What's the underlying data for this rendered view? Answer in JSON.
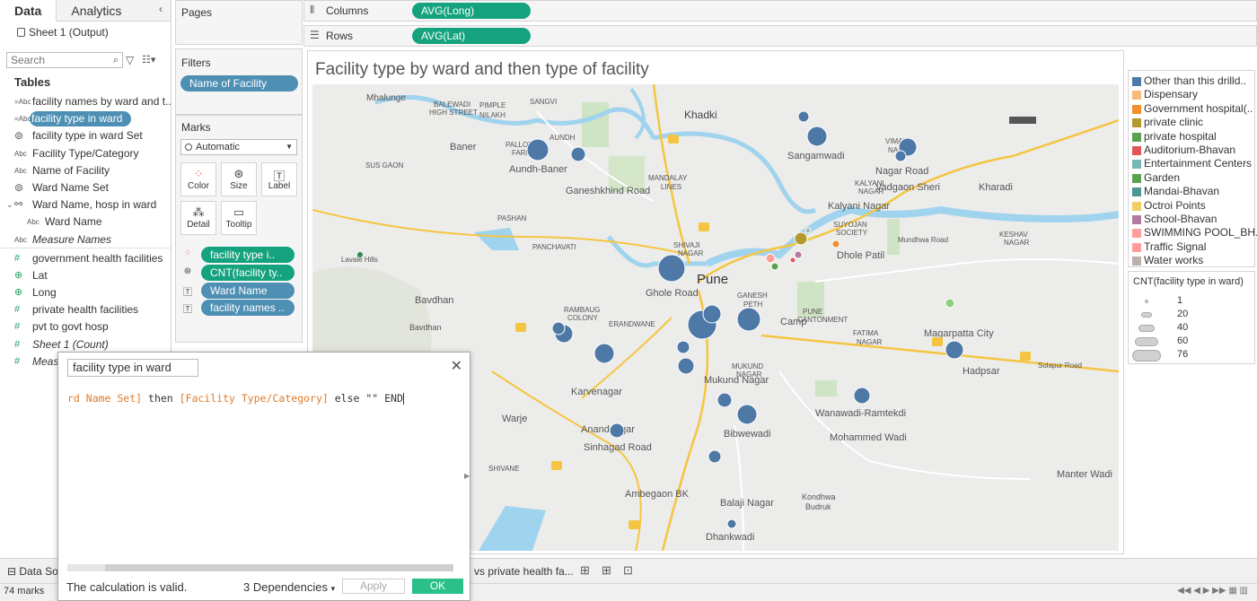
{
  "datapane": {
    "tabs": [
      "Data",
      "Analytics"
    ],
    "collapse_glyph": "‹",
    "source": "Sheet 1 (Output)",
    "search_placeholder": "Search",
    "tables_heading": "Tables",
    "fields": [
      {
        "label": "facility names by ward and t...",
        "icon": "Abc"
      },
      {
        "label": "facility type in ward",
        "icon": "Abc",
        "selected": true
      },
      {
        "label": "facility type in ward Set",
        "icon": "set"
      },
      {
        "label": "Facility Type/Category",
        "icon": "Abc"
      },
      {
        "label": "Name of Facility",
        "icon": "Abc"
      },
      {
        "label": "Ward Name Set",
        "icon": "set"
      },
      {
        "label": "Ward Name, hosp in ward",
        "icon": "hierarchy"
      },
      {
        "label": "Ward Name",
        "icon": "Abc"
      },
      {
        "label": "Measure Names",
        "icon": "Abc"
      },
      {
        "label": "government health facilities",
        "icon": "#"
      },
      {
        "label": "Lat",
        "icon": "globe"
      },
      {
        "label": "Long",
        "icon": "globe"
      },
      {
        "label": "private health facilities",
        "icon": "#"
      },
      {
        "label": "pvt to govt hosp",
        "icon": "#"
      },
      {
        "label": "Sheet 1 (Count)",
        "icon": "#"
      },
      {
        "label": "Meas",
        "icon": "#"
      }
    ]
  },
  "pages": {
    "title": "Pages"
  },
  "filters": {
    "title": "Filters",
    "pill": "Name of Facility"
  },
  "marks": {
    "title": "Marks",
    "type": "Automatic",
    "buttons": [
      "Color",
      "Size",
      "Label",
      "Detail",
      "Tooltip"
    ],
    "rows": [
      "facility type i..",
      "CNT(facility ty..",
      "Ward Name",
      "facility names .."
    ]
  },
  "shelves": {
    "columns_label": "Columns",
    "columns_pill": "AVG(Long)",
    "rows_label": "Rows",
    "rows_pill": "AVG(Lat)"
  },
  "view": {
    "title": "Facility type by ward and then type of facility"
  },
  "map_labels": [
    "Mhalunge",
    "BALEWADI",
    "HIGH STREET",
    "PIMPLE",
    "NILAKH",
    "SANGVI",
    "Baner",
    "PALLOD",
    "FARM",
    "AUNDH",
    "Aundh-Baner",
    "Khadki",
    "Sangamwadi",
    "Nagar Road",
    "Vadgaon Sheri",
    "Kharadi",
    "Ganeshkhind Road",
    "MANDALAY",
    "LINES",
    "SUS GAON",
    "PASHAN",
    "Kalyani Nagar",
    "KALYANI",
    "NAGAR",
    "PANCHAVATI",
    "SHIVAJI",
    "NAGAR",
    "Lavale Hills",
    "Pune",
    "Dhole Patil",
    "Ghole Road",
    "Bavdhan",
    "RAMBAUG",
    "COLONY",
    "ERANDWANE",
    "GANESH",
    "PETH",
    "Camp",
    "PUNE",
    "CANTONMENT",
    "FATIMA",
    "NAGAR",
    "Magarpatta City",
    "Hadpsar",
    "MUKUND",
    "NAGAR",
    "Mukund Nagar",
    "Karvenagar",
    "Warje",
    "Anandnagar",
    "Sinhagad Road",
    "Bibwewadi",
    "Wanawadi-Ramtekdi",
    "Mohammed Wadi",
    "Ambegaon BK",
    "Balaji Nagar",
    "Kondhwa",
    "Budruk",
    "Dhankwadi",
    "Manter Wadi",
    "SHIVANE",
    "Mundhwa Road",
    "Solapur Road",
    "VIMAN",
    "NAGAR",
    "SUYOJAN",
    "SOCIETY",
    "KESHAV",
    "NAGAR",
    "Bavdhan"
  ],
  "color_legend": {
    "items": [
      {
        "label": "Other than this drilld..",
        "color": "#4e79a7"
      },
      {
        "label": "Dispensary",
        "color": "#f8b97a"
      },
      {
        "label": "Government hospital(..",
        "color": "#f28e2b"
      },
      {
        "label": "private clinic",
        "color": "#b6992d"
      },
      {
        "label": "private hospital",
        "color": "#59a14f"
      },
      {
        "label": "Auditorium-Bhavan",
        "color": "#e15759"
      },
      {
        "label": "Entertainment Centers",
        "color": "#76b7b2"
      },
      {
        "label": "Garden",
        "color": "#59a14f"
      },
      {
        "label": "Mandai-Bhavan",
        "color": "#499894"
      },
      {
        "label": "Octroi Points",
        "color": "#f1ce63"
      },
      {
        "label": "School-Bhavan",
        "color": "#b07aa1"
      },
      {
        "label": "SWIMMING POOL_BH..",
        "color": "#ff9d9a"
      },
      {
        "label": "Traffic Signal",
        "color": "#ff9d9a"
      },
      {
        "label": "Water works",
        "color": "#bab0ac"
      }
    ]
  },
  "size_legend": {
    "title": "CNT(facility type in ward)",
    "items": [
      {
        "label": "1",
        "size": 1
      },
      {
        "label": "20",
        "size": 20
      },
      {
        "label": "40",
        "size": 40
      },
      {
        "label": "60",
        "size": 60
      },
      {
        "label": "76",
        "size": 76
      }
    ]
  },
  "bottom": {
    "datasource_tab": "Data Sou",
    "sheet_tab": "vs private health fa...",
    "marks_count": "74 marks"
  },
  "dialog": {
    "name": "facility type in ward",
    "code": {
      "part1": "rd Name Set]",
      "part2": " then ",
      "part3": "[Facility Type/Category]",
      "part4": " else \"\" END"
    },
    "status": "The calculation is valid.",
    "deps": "3 Dependencies",
    "apply": "Apply",
    "ok": "OK"
  },
  "colors": {
    "accent_pill_blue": "#4e8fb4",
    "accent_pill_green": "#14a37e",
    "ok_green": "#2bbf8a",
    "map_bubble": "#4e79a7"
  }
}
